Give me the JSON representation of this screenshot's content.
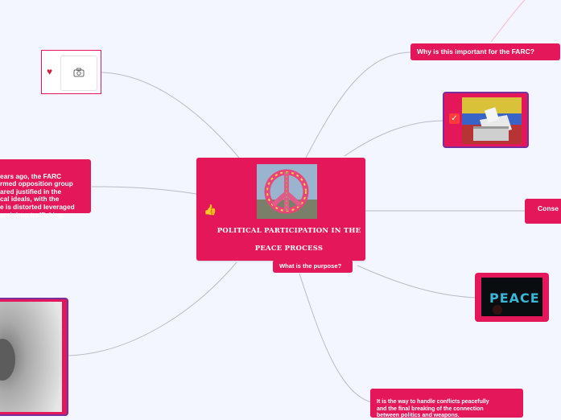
{
  "mindmap": {
    "center": {
      "title": "POLITICAL PARTICIPATION IN THE PEACE PROCESS",
      "image": "peace-sign-flowers-icon",
      "icon": "thumbs-up-icon"
    },
    "topics": {
      "why_important": "Why is this important for the FARC?",
      "purpose": "What is the purpose?",
      "consequences": "Conse",
      "history": "ears ago, the FARC\nrmed opposition group\nared justified in the\ncal ideals, with the\ne is distorted leveraged\nand drug trafficking.",
      "answer": "It is the way to handle conflicts peacefully\nand the final breaking of the connection\nbetween politics and weapons."
    },
    "icons": {
      "placeholder_heart": "heart-icon",
      "placeholder_camera": "camera-icon",
      "ballot_check": "check-icon"
    },
    "colors": {
      "background": "#f3f5ff",
      "node": "#e3175a",
      "node_border": "#7a2f9e",
      "link": "#b9bcc8",
      "link_pink": "#f6b9d2"
    }
  }
}
